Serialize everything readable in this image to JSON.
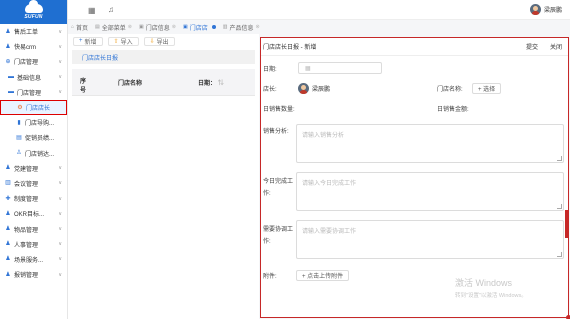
{
  "logo": {
    "text": "SUFUN"
  },
  "sidebar": {
    "items": [
      {
        "label": "售后工单",
        "icon": "user-icon"
      },
      {
        "label": "快易crm",
        "icon": "user-icon"
      },
      {
        "label": "门店管理",
        "icon": "store-icon"
      },
      {
        "label": "基础信息",
        "icon": "folder-icon"
      },
      {
        "label": "门店管理",
        "icon": "folder-icon"
      },
      {
        "label": "门店店长",
        "icon": "gear-icon"
      },
      {
        "label": "门店导购...",
        "icon": "chart-icon"
      },
      {
        "label": "促销员绩...",
        "icon": "doc-icon"
      },
      {
        "label": "门店销达...",
        "icon": "person-icon"
      },
      {
        "label": "党建管理",
        "icon": "user-icon"
      },
      {
        "label": "会议管理",
        "icon": "meeting-icon"
      },
      {
        "label": "制度管理",
        "icon": "plus-icon"
      },
      {
        "label": "OKR目标...",
        "icon": "user-icon"
      },
      {
        "label": "物品管理",
        "icon": "user-icon"
      },
      {
        "label": "人事管理",
        "icon": "user-icon"
      },
      {
        "label": "场景服务...",
        "icon": "user-icon"
      },
      {
        "label": "报销管理",
        "icon": "user-icon"
      }
    ]
  },
  "topbar": {
    "user_name": "梁辰鹏"
  },
  "tabs": [
    {
      "label": "首页",
      "icon": "home-icon"
    },
    {
      "label": "全部菜单",
      "icon": "menu-icon"
    },
    {
      "label": "门店信息",
      "icon": "doc-icon"
    },
    {
      "label": "门店店",
      "icon": "doc-icon",
      "active": true
    },
    {
      "label": "产品信息",
      "icon": "table-icon"
    }
  ],
  "list": {
    "buttons": {
      "add": "新增",
      "import": "导入",
      "export": "导出"
    },
    "section_title": "门店店长日报",
    "columns": {
      "index": "序号",
      "store": "门店名称",
      "date": "日期："
    }
  },
  "detail": {
    "title": "门店店长日报 - 新增",
    "actions": {
      "submit": "提交",
      "close": "关闭"
    },
    "fields": {
      "date_label": "日期:",
      "manager_label": "店长:",
      "manager_name": "梁辰鹏",
      "store_label": "门店名称:",
      "select_label": "+ 选择",
      "sales_qty_label": "日销售数量:",
      "sales_amount_label": "日销售金额:",
      "analysis_label": "销售分析:",
      "analysis_placeholder": "请输入销售分析",
      "work_label": "今日完成工作:",
      "work_placeholder": "请输入今日完成工作",
      "coop_label": "需要协调工作:",
      "coop_placeholder": "请输入需要协调工作",
      "attach_label": "附件:",
      "upload_label": "+ 点击上传附件"
    },
    "watermark": {
      "line1": "激活 Windows",
      "line2": "转到\"设置\"以激活 Windows。"
    }
  }
}
